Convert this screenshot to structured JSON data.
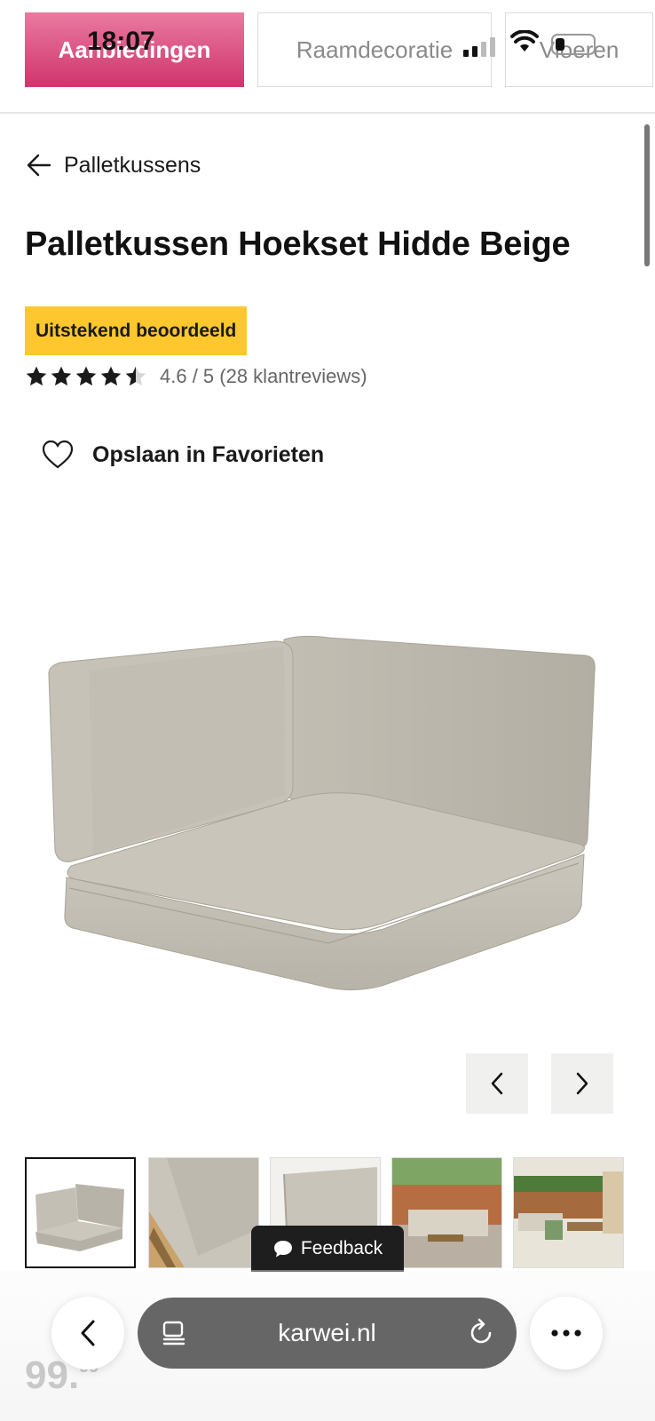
{
  "status_bar": {
    "time": "18:07"
  },
  "categories": [
    {
      "label": "Aanbiedingen",
      "active": true
    },
    {
      "label": "Raamdecoratie",
      "active": false
    },
    {
      "label": "Vloeren",
      "active": false
    }
  ],
  "breadcrumb": {
    "label": "Palletkussens",
    "icon": "arrow-left-icon"
  },
  "product": {
    "title": "Palletkussen Hoekset Hidde Beige",
    "badge": "Uitstekend beoordeeld",
    "rating": 4.6,
    "rating_text": "4.6 / 5 (28 klantreviews)",
    "favorite_label": "Opslaan in Favorieten",
    "price_whole": "99.",
    "price_cents": "99"
  },
  "gallery": {
    "thumbnail_count": 5,
    "selected_index": 0
  },
  "feedback": {
    "label": "Feedback"
  },
  "browser": {
    "url": "karwei.nl"
  },
  "colors": {
    "brand_pink": "#d0346c",
    "badge_yellow": "#fdc72d",
    "url_bar": "#666666"
  }
}
